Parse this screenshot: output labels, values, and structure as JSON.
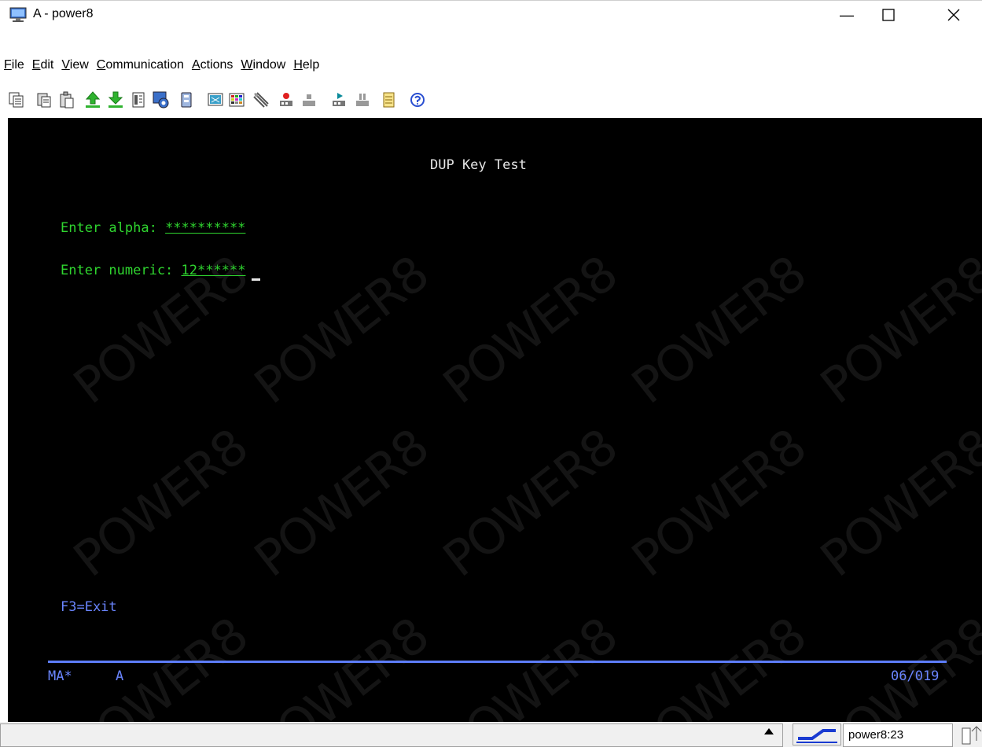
{
  "window": {
    "title": "A - power8",
    "icons": {
      "app": "monitor-icon",
      "minimize": "minimize-icon",
      "maximize": "maximize-icon",
      "close": "close-icon"
    },
    "minimize_glyph": "—",
    "maximize_glyph": "☐",
    "close_glyph": "✕"
  },
  "menu": {
    "items": [
      {
        "label": "File",
        "mnemonic": "F"
      },
      {
        "label": "Edit",
        "mnemonic": "E"
      },
      {
        "label": "View",
        "mnemonic": "V"
      },
      {
        "label": "Communication",
        "mnemonic": "C"
      },
      {
        "label": "Actions",
        "mnemonic": "A"
      },
      {
        "label": "Window",
        "mnemonic": "W"
      },
      {
        "label": "Help",
        "mnemonic": "H"
      }
    ]
  },
  "toolbar": {
    "icons": [
      "copy-icon",
      "paste-icon",
      "paste-next-icon",
      "send-file-icon",
      "receive-file-icon",
      "display-keypad-icon",
      "macro-icon",
      "quick-settings-icon",
      "display-icon",
      "color-map-icon",
      "keyboard-map-icon",
      "record-macro-icon",
      "stop-macro-icon",
      "play-macro-icon",
      "pause-macro-icon",
      "notepad-icon",
      "help-icon"
    ]
  },
  "terminal": {
    "watermark": "POWER8",
    "screen_title": "DUP Key Test",
    "alpha_label": "Enter alpha: ",
    "alpha_value": "**********",
    "numeric_label": "Enter numeric: ",
    "numeric_value_typed": "12",
    "numeric_value_dup": "******",
    "function_keys": "F3=Exit",
    "status_indicator": "MA*",
    "status_session": "A",
    "cursor_position": "06/019"
  },
  "statusbar": {
    "host": "power8:23",
    "icons": {
      "scroll": "up-arrow-icon",
      "connection": "connection-icon",
      "grip": "resize-grip-icon"
    }
  },
  "colors": {
    "terminal_bg": "#000000",
    "field_green": "#2fd52f",
    "status_blue": "#6a85ff",
    "title_white": "#e6e6e6"
  }
}
